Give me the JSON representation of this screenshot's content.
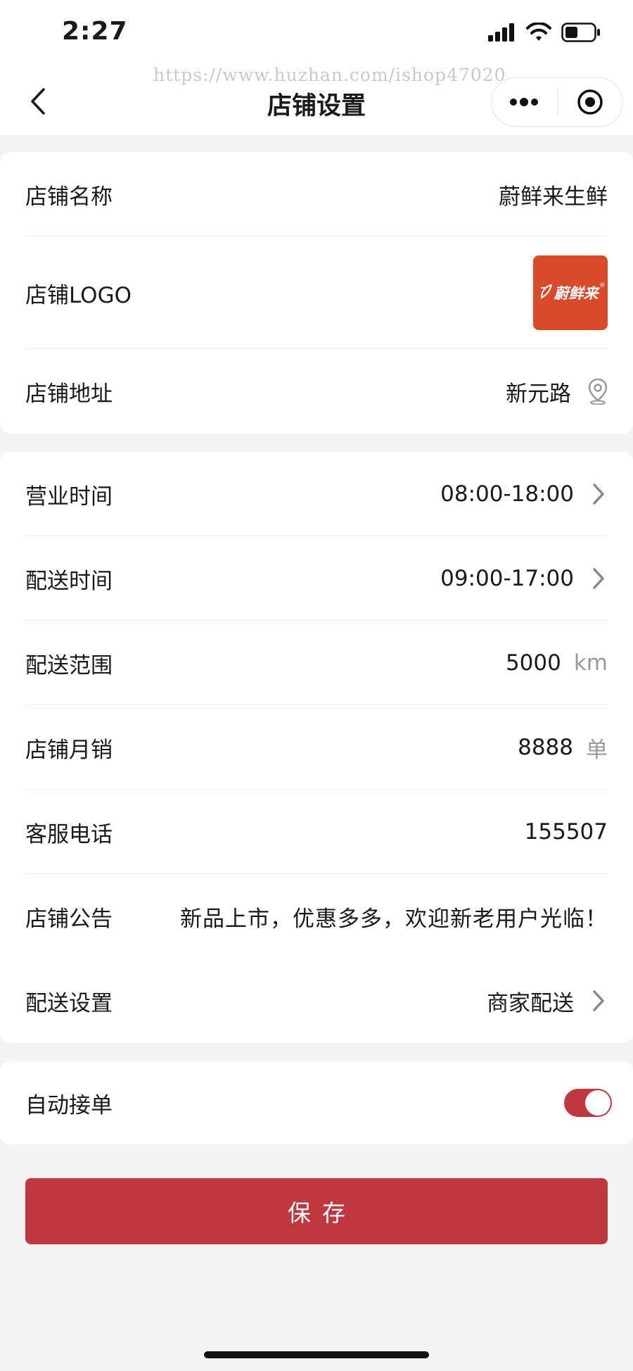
{
  "status_bar": {
    "time": "2:27"
  },
  "watermark": "https://www.huzhan.com/ishop47020",
  "nav": {
    "title": "店铺设置"
  },
  "shop_info": {
    "name_label": "店铺名称",
    "name_value": "蔚鲜来生鲜",
    "logo_label": "店铺LOGO",
    "logo_text": "蔚鲜来",
    "address_label": "店铺地址",
    "address_value": "新元路"
  },
  "details": {
    "hours_label": "营业时间",
    "hours_value": "08:00-18:00",
    "delivery_time_label": "配送时间",
    "delivery_time_value": "09:00-17:00",
    "range_label": "配送范围",
    "range_value": "5000",
    "range_unit": "km",
    "monthly_sales_label": "店铺月销",
    "monthly_sales_value": "8888",
    "monthly_sales_unit": "单",
    "phone_label": "客服电话",
    "phone_value": "155507",
    "notice_label": "店铺公告",
    "notice_value": "新品上市，优惠多多，欢迎新老用户光临！",
    "delivery_setting_label": "配送设置",
    "delivery_setting_value": "商家配送"
  },
  "auto_accept": {
    "label": "自动接单",
    "enabled": true
  },
  "save_label": "保存",
  "colors": {
    "accent": "#c0383d",
    "logo_bg": "#d94a2b",
    "page_bg": "#f4f4f4"
  }
}
